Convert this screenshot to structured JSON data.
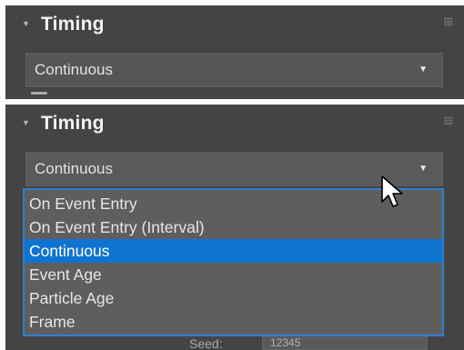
{
  "top_panel": {
    "rollout_title": "Timing",
    "dropdown_value": "Continuous"
  },
  "bottom_panel": {
    "rollout_title": "Timing",
    "dropdown_value": "Continuous",
    "options": [
      {
        "label": "On Event Entry",
        "selected": false
      },
      {
        "label": "On Event Entry (Interval)",
        "selected": false
      },
      {
        "label": "Continuous",
        "selected": true
      },
      {
        "label": "Event Age",
        "selected": false
      },
      {
        "label": "Particle Age",
        "selected": false
      },
      {
        "label": "Frame",
        "selected": false
      }
    ],
    "partially_hidden_row": {
      "label": "Seed:",
      "value": "12345"
    }
  },
  "colors": {
    "panel_bg": "#444444",
    "dropdown_bg": "#565656",
    "selection": "#0f74d0",
    "list_border": "#2f7fcb"
  },
  "icons": [
    "collapse-arrow-icon",
    "dropdown-caret-icon",
    "grip-icon",
    "mouse-pointer-icon"
  ]
}
